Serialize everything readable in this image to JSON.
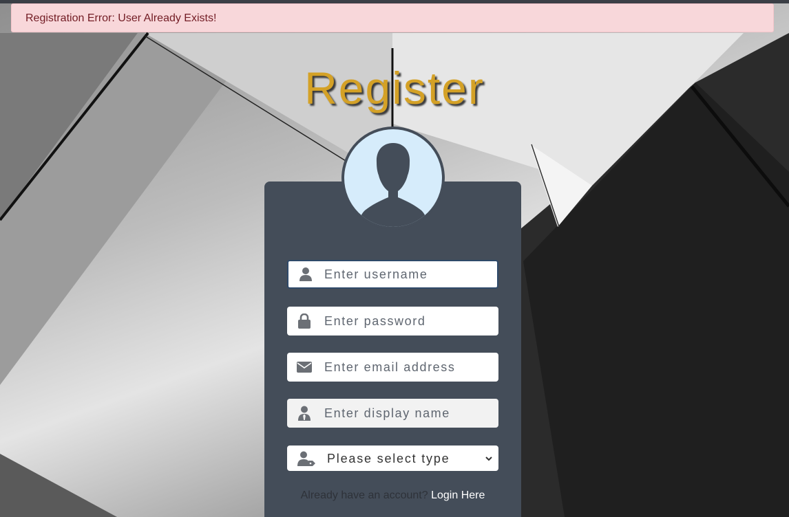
{
  "alert": {
    "message": "Registration Error: User Already Exists!"
  },
  "title": "Register",
  "form": {
    "username": {
      "placeholder": "Enter username",
      "icon": "user-icon"
    },
    "password": {
      "placeholder": "Enter password",
      "icon": "lock-icon"
    },
    "email": {
      "placeholder": "Enter email address",
      "icon": "envelope-icon"
    },
    "display_name": {
      "placeholder": "Enter display name",
      "icon": "user-tie-icon"
    },
    "type": {
      "selected": "Please select type",
      "icon": "user-tag-icon"
    }
  },
  "footer": {
    "prompt": "Already have an account?",
    "link": "Login Here"
  },
  "colors": {
    "accent_title": "#d4a126",
    "card": "#444d59",
    "alert_bg": "#f8d7da",
    "alert_text": "#721c24",
    "avatar_bg": "#d6ecfb"
  }
}
